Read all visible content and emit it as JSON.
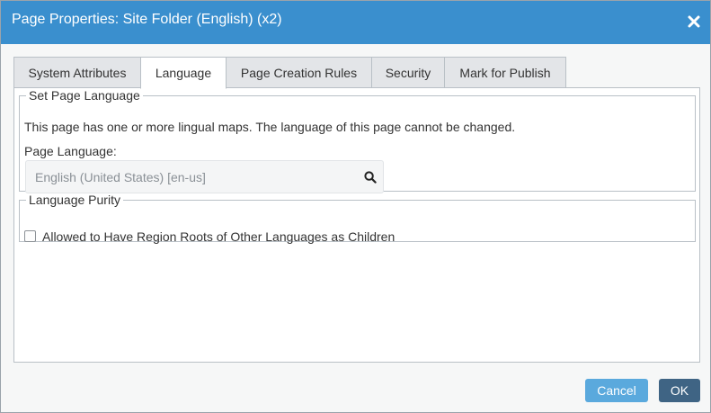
{
  "dialog": {
    "title": "Page Properties: Site Folder (English) (x2)"
  },
  "tabs": [
    {
      "label": "System Attributes",
      "active": false
    },
    {
      "label": "Language",
      "active": true
    },
    {
      "label": "Page Creation Rules",
      "active": false
    },
    {
      "label": "Security",
      "active": false
    },
    {
      "label": "Mark for Publish",
      "active": false
    }
  ],
  "set_language": {
    "legend": "Set Page Language",
    "info": "This page has one or more lingual maps. The language of this page cannot be changed.",
    "field_label": "Page Language:",
    "field_value": "English (United States) [en-us]"
  },
  "language_purity": {
    "legend": "Language Purity",
    "checkbox_label": "Allowed to Have Region Roots of Other Languages as Children",
    "checked": false
  },
  "buttons": {
    "cancel": "Cancel",
    "ok": "OK"
  },
  "colors": {
    "titlebar": "#3a8fce",
    "cancel_button": "#5aa9dd",
    "ok_button": "#3f6484"
  }
}
